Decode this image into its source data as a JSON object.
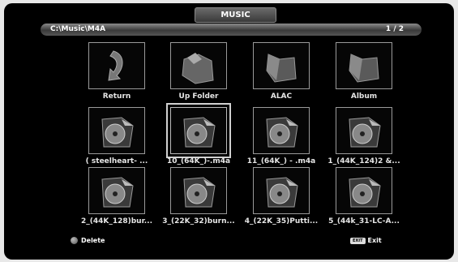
{
  "header": {
    "title": "MUSIC"
  },
  "path_bar": {
    "path": "C:\\Music\\M4A",
    "page": "1 / 2"
  },
  "items": [
    {
      "label": "Return",
      "icon": "return-arrow-icon"
    },
    {
      "label": "Up Folder",
      "icon": "up-folder-icon"
    },
    {
      "label": "ALAC",
      "icon": "folder-icon"
    },
    {
      "label": "Album",
      "icon": "folder-icon"
    },
    {
      "label": "( steelheart-     ...",
      "icon": "music-file-icon"
    },
    {
      "label": "10_(64K_)-.m4a",
      "icon": "music-file-icon",
      "selected": true
    },
    {
      "label": "11_(64K_) - .m4a",
      "icon": "music-file-icon"
    },
    {
      "label": "1_(44K_124)2 &...",
      "icon": "music-file-icon"
    },
    {
      "label": "2_(44K_128)bur...",
      "icon": "music-file-icon"
    },
    {
      "label": "3_(22K_32)burn...",
      "icon": "music-file-icon"
    },
    {
      "label": "4_(22K_35)Putti...",
      "icon": "music-file-icon"
    },
    {
      "label": "5_(44k_31-LC-A...",
      "icon": "music-file-icon"
    }
  ],
  "footer": {
    "delete_label": "Delete",
    "exit_key": "EXIT",
    "exit_label": "Exit"
  }
}
